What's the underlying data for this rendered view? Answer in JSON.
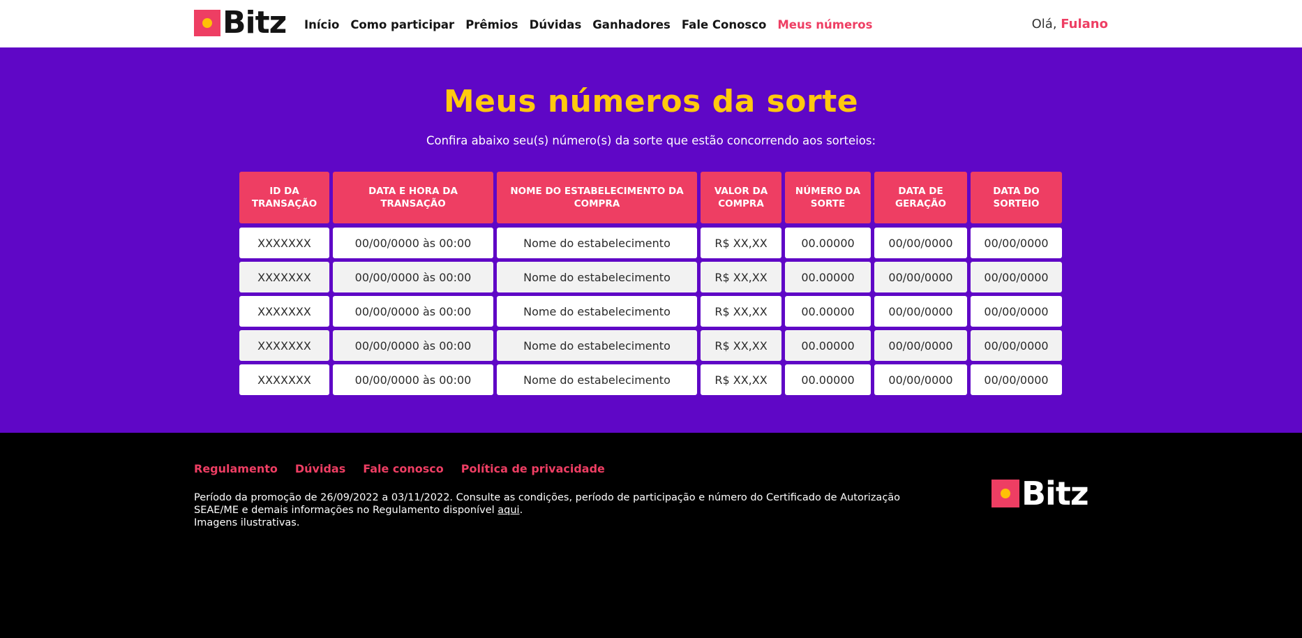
{
  "header": {
    "logo_text": "Bitz",
    "nav": [
      "Início",
      "Como participar",
      "Prêmios",
      "Dúvidas",
      "Ganhadores",
      "Fale Conosco",
      "Meus números"
    ],
    "greeting_prefix": "Olá,",
    "user_name": "Fulano"
  },
  "main": {
    "title": "Meus números da sorte",
    "subtitle": "Confira abaixo seu(s) número(s) da sorte que estão concorrendo aos sorteios:",
    "columns": [
      "ID DA TRANSAÇÃO",
      "DATA E HORA DA TRANSAÇÃO",
      "NOME DO ESTABELECIMENTO DA COMPRA",
      "VALOR DA COMPRA",
      "NÚMERO DA SORTE",
      "DATA DE GERAÇÃO",
      "DATA DO SORTEIO"
    ],
    "rows": [
      [
        "XXXXXXX",
        "00/00/0000 às 00:00",
        "Nome do estabelecimento",
        "R$ XX,XX",
        "00.00000",
        "00/00/0000",
        "00/00/0000"
      ],
      [
        "XXXXXXX",
        "00/00/0000 às 00:00",
        "Nome do estabelecimento",
        "R$ XX,XX",
        "00.00000",
        "00/00/0000",
        "00/00/0000"
      ],
      [
        "XXXXXXX",
        "00/00/0000 às 00:00",
        "Nome do estabelecimento",
        "R$ XX,XX",
        "00.00000",
        "00/00/0000",
        "00/00/0000"
      ],
      [
        "XXXXXXX",
        "00/00/0000 às 00:00",
        "Nome do estabelecimento",
        "R$ XX,XX",
        "00.00000",
        "00/00/0000",
        "00/00/0000"
      ],
      [
        "XXXXXXX",
        "00/00/0000 às 00:00",
        "Nome do estabelecimento",
        "R$ XX,XX",
        "00.00000",
        "00/00/0000",
        "00/00/0000"
      ]
    ]
  },
  "footer": {
    "links": [
      "Regulamento",
      "Dúvidas",
      "Fale conosco",
      "Política de privacidade"
    ],
    "text_line1": "Período da promoção de 26/09/2022 a 03/11/2022. Consulte as condições, período de participação e número do Certificado de Autorização SEAE/ME e demais informações no Regulamento disponível ",
    "text_link": "aqui",
    "text_end": ".",
    "text_line2": "Imagens ilustrativas.",
    "logo_text": "Bitz"
  },
  "colors": {
    "primary_purple": "#5f07c6",
    "accent_pink": "#ee3e63",
    "title_yellow": "#ffc90e",
    "logo_dot_yellow": "#ffc107"
  }
}
